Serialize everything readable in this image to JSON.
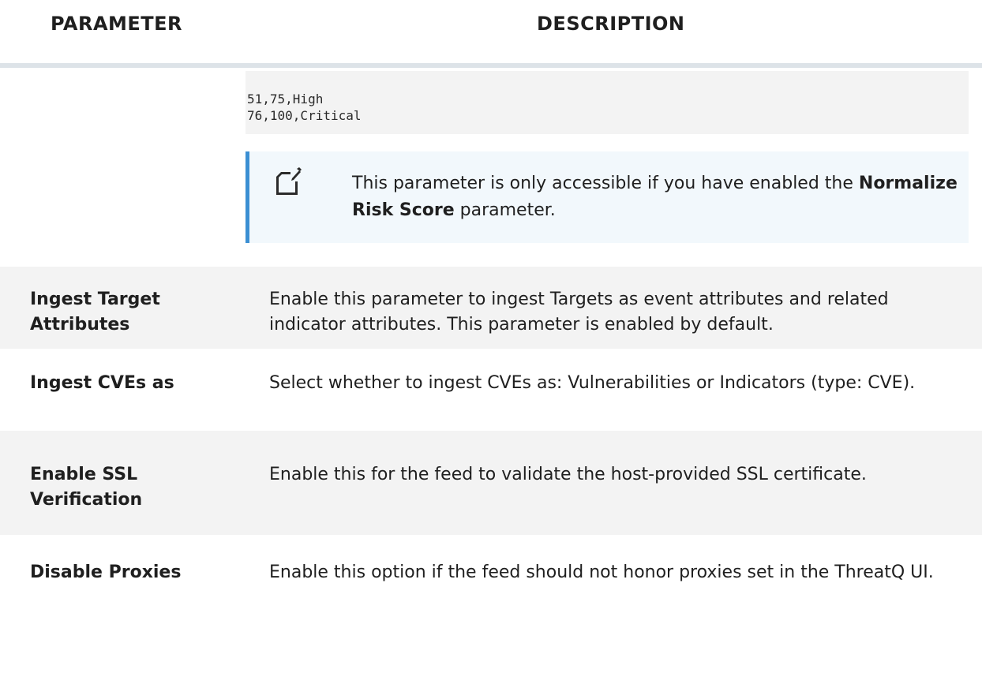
{
  "header": {
    "parameter": "PARAMETER",
    "description": "DESCRIPTION"
  },
  "risk_row": {
    "code_lines": "51,75,High\n76,100,Critical",
    "note_prefix": "This parameter is only accessible if you have enabled the",
    "note_strong": "Normalize Risk Score",
    "note_suffix": " parameter.",
    "note_icon": "note-edit-icon"
  },
  "rows": [
    {
      "parameter": "Ingest Target Attributes",
      "description": "Enable this parameter to ingest Targets as event attributes and related indicator attributes. This parameter is enabled by default."
    },
    {
      "parameter": "Ingest CVEs as",
      "description": "Select whether to ingest CVEs as: Vulnerabilities or Indicators (type: CVE)."
    },
    {
      "parameter": "Enable SSL Verification",
      "description": "Enable this for the feed to validate the host-provided SSL certificate."
    },
    {
      "parameter": "Disable Proxies",
      "description": "Enable this option if the feed should not honor proxies set in the ThreatQ UI."
    }
  ],
  "colors": {
    "note_border": "#3b8fd3",
    "note_background": "#f2f8fc",
    "row_shaded": "#f3f3f3",
    "header_rule": "#dde3e8"
  }
}
